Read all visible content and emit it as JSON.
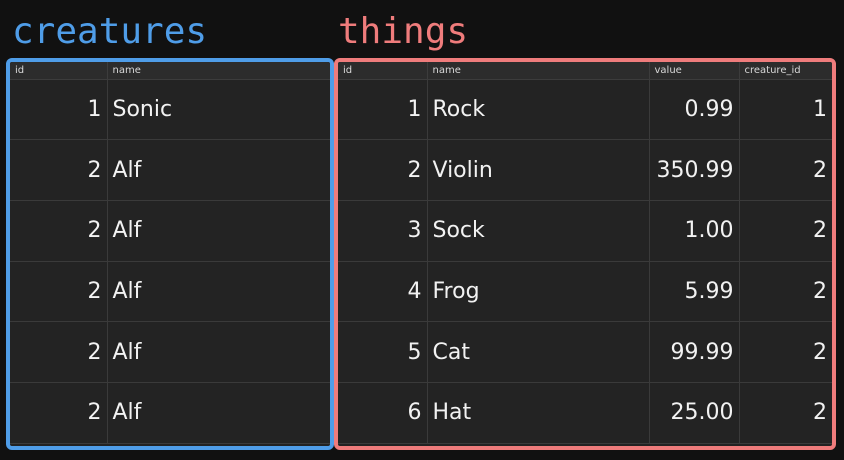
{
  "creatures": {
    "title": "creatures",
    "columns": [
      "id",
      "name"
    ],
    "rows": [
      [
        "1",
        "Sonic"
      ],
      [
        "2",
        "Alf"
      ],
      [
        "2",
        "Alf"
      ],
      [
        "2",
        "Alf"
      ],
      [
        "2",
        "Alf"
      ],
      [
        "2",
        "Alf"
      ]
    ]
  },
  "things": {
    "title": "things",
    "columns": [
      "id",
      "name",
      "value",
      "creature_id"
    ],
    "rows": [
      [
        "1",
        "Rock",
        "0.99",
        "1"
      ],
      [
        "2",
        "Violin",
        "350.99",
        "2"
      ],
      [
        "3",
        "Sock",
        "1.00",
        "2"
      ],
      [
        "4",
        "Frog",
        "5.99",
        "2"
      ],
      [
        "5",
        "Cat",
        "99.99",
        "2"
      ],
      [
        "6",
        "Hat",
        "25.00",
        "2"
      ]
    ]
  },
  "colors": {
    "creatures_accent": "#4f9de8",
    "things_accent": "#ef7c7c",
    "background": "#111111",
    "table_bg": "#232323"
  }
}
